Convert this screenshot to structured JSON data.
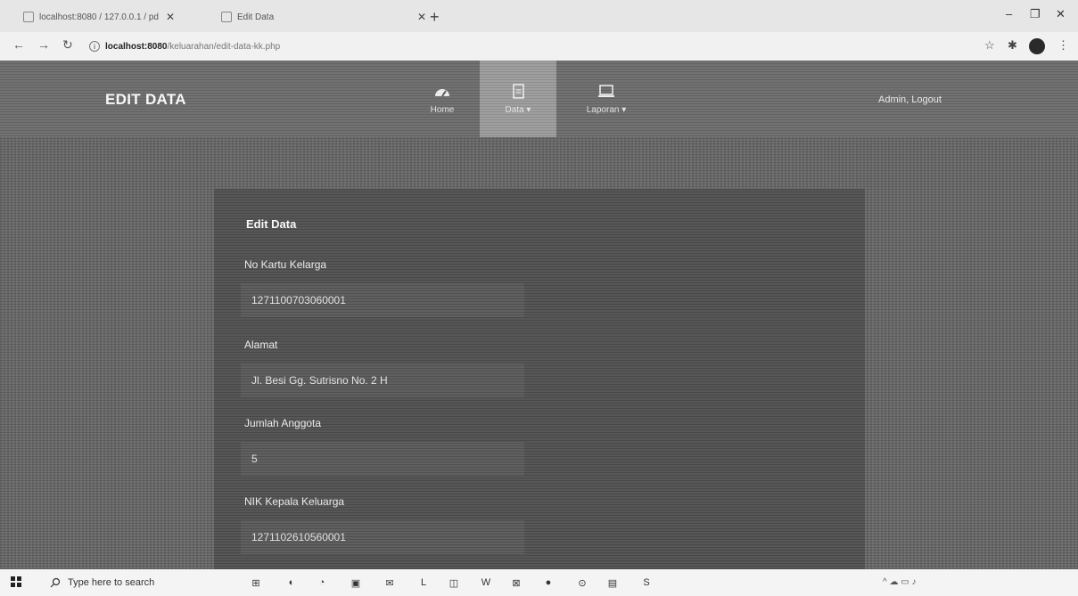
{
  "browser": {
    "tabs": [
      {
        "label": "localhost:8080 / 127.0.0.1 / pd"
      },
      {
        "label": "Edit Data"
      }
    ],
    "url_host": "localhost:8080",
    "url_path": "/keluarahan/edit-data-kk.php"
  },
  "header": {
    "brand": "EDIT DATA",
    "nav": [
      {
        "label": "Home"
      },
      {
        "label": "Data ▾"
      },
      {
        "label": "Laporan ▾"
      }
    ],
    "user_link": "Admin, Logout"
  },
  "form": {
    "title": "Edit Data",
    "fields": [
      {
        "label": "No Kartu Kelarga",
        "value": "1271100703060001"
      },
      {
        "label": "Alamat",
        "value": "Jl. Besi Gg. Sutrisno No. 2 H"
      },
      {
        "label": "Jumlah Anggota",
        "value": "5"
      },
      {
        "label": "NIK Kepala Keluarga",
        "value": "1271102610560001"
      }
    ]
  },
  "taskbar": {
    "search_placeholder": "Type here to search"
  },
  "colors": {
    "header_bg": "#6a6a6a",
    "active_nav_bg": "#9a9a9a",
    "panel_bg": "#4e4e4e",
    "input_bg": "#575757"
  }
}
